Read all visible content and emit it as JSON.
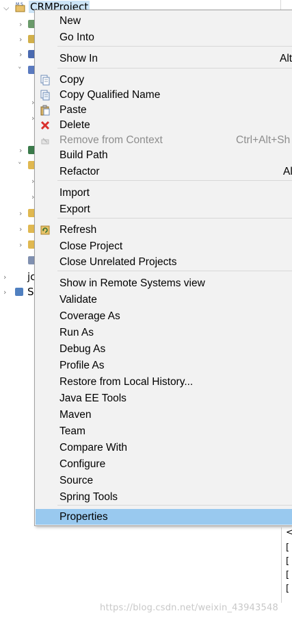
{
  "explorer": {
    "project_name": "CRMProject",
    "row_texts": [
      "jc",
      "S"
    ]
  },
  "bottom_panel": {
    "lines": [
      "<",
      "[",
      "[",
      "[",
      "["
    ]
  },
  "watermark": "https://blog.csdn.net/weixin_43943548",
  "menu": {
    "items": [
      {
        "label": "New",
        "shortcut": "",
        "icon": "",
        "disabled": false
      },
      {
        "label": "Go Into",
        "shortcut": "",
        "icon": "",
        "disabled": false
      },
      {
        "label": "Show In",
        "shortcut": "Alt",
        "icon": "",
        "disabled": false
      },
      {
        "label": "Copy",
        "shortcut": "",
        "icon": "copy-icon",
        "disabled": false
      },
      {
        "label": "Copy Qualified Name",
        "shortcut": "",
        "icon": "copy-qualified-name-icon",
        "disabled": false
      },
      {
        "label": "Paste",
        "shortcut": "",
        "icon": "paste-icon",
        "disabled": false
      },
      {
        "label": "Delete",
        "shortcut": "",
        "icon": "delete-icon",
        "disabled": false
      },
      {
        "label": "Remove from Context",
        "shortcut": "Ctrl+Alt+Sh",
        "icon": "remove-context-icon",
        "disabled": true
      },
      {
        "label": "Build Path",
        "shortcut": "",
        "icon": "",
        "disabled": false
      },
      {
        "label": "Refactor",
        "shortcut": "Al",
        "icon": "",
        "disabled": false
      },
      {
        "label": "Import",
        "shortcut": "",
        "icon": "",
        "disabled": false
      },
      {
        "label": "Export",
        "shortcut": "",
        "icon": "",
        "disabled": false
      },
      {
        "label": "Refresh",
        "shortcut": "",
        "icon": "refresh-icon",
        "disabled": false
      },
      {
        "label": "Close Project",
        "shortcut": "",
        "icon": "",
        "disabled": false
      },
      {
        "label": "Close Unrelated Projects",
        "shortcut": "",
        "icon": "",
        "disabled": false
      },
      {
        "label": "Show in Remote Systems view",
        "shortcut": "",
        "icon": "",
        "disabled": false
      },
      {
        "label": "Validate",
        "shortcut": "",
        "icon": "",
        "disabled": false
      },
      {
        "label": "Coverage As",
        "shortcut": "",
        "icon": "",
        "disabled": false
      },
      {
        "label": "Run As",
        "shortcut": "",
        "icon": "",
        "disabled": false
      },
      {
        "label": "Debug As",
        "shortcut": "",
        "icon": "",
        "disabled": false
      },
      {
        "label": "Profile As",
        "shortcut": "",
        "icon": "",
        "disabled": false
      },
      {
        "label": "Restore from Local History...",
        "shortcut": "",
        "icon": "",
        "disabled": false
      },
      {
        "label": "Java EE Tools",
        "shortcut": "",
        "icon": "",
        "disabled": false
      },
      {
        "label": "Maven",
        "shortcut": "",
        "icon": "",
        "disabled": false
      },
      {
        "label": "Team",
        "shortcut": "",
        "icon": "",
        "disabled": false
      },
      {
        "label": "Compare With",
        "shortcut": "",
        "icon": "",
        "disabled": false
      },
      {
        "label": "Configure",
        "shortcut": "",
        "icon": "",
        "disabled": false
      },
      {
        "label": "Source",
        "shortcut": "",
        "icon": "",
        "disabled": false
      },
      {
        "label": "Spring Tools",
        "shortcut": "",
        "icon": "",
        "disabled": false
      },
      {
        "label": "Properties",
        "shortcut": "",
        "icon": "",
        "disabled": false,
        "highlighted": true
      }
    ]
  },
  "colors": {
    "menu_background": "#f2f2f2",
    "highlight": "#99c9ef",
    "disabled_text": "#8d8d8d",
    "delete_red": "#d9302c",
    "selection": "#cce4f7"
  }
}
